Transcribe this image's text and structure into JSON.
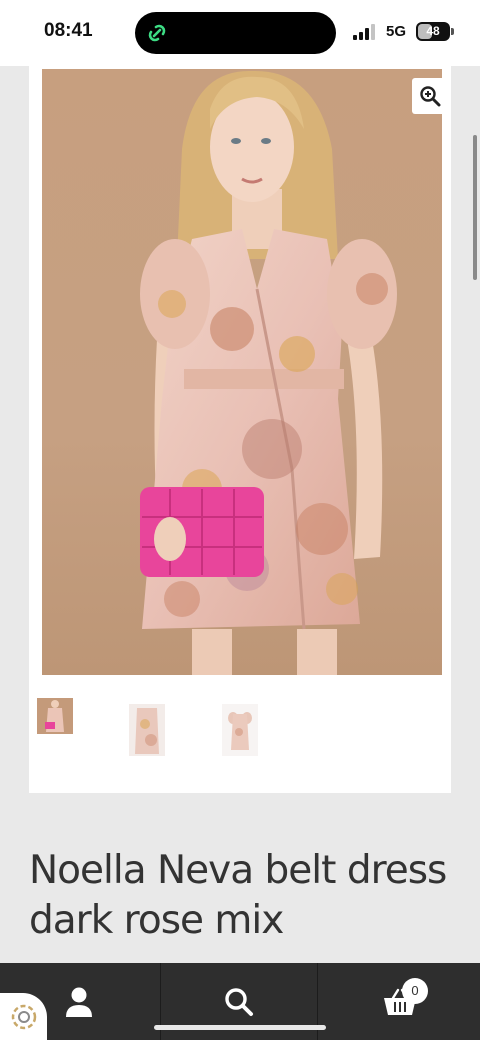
{
  "status_bar": {
    "time": "08:41",
    "network": "5G",
    "battery_level": "48",
    "battery_fraction": 0.48,
    "island_icon": "chain-link-icon",
    "signal_icon": "cellular-signal-icon"
  },
  "product": {
    "title": "Noella Neva belt dress dark rose mix",
    "zoom_icon": "zoom-in-icon",
    "thumbnails": [
      {
        "name": "thumbnail-1"
      },
      {
        "name": "thumbnail-2"
      },
      {
        "name": "thumbnail-3"
      }
    ]
  },
  "bottom_nav": {
    "account_icon": "user-icon",
    "search_icon": "search-icon",
    "cart_icon": "basket-icon",
    "cart_count": "0"
  },
  "colors": {
    "nav_background": "#2e2e2e",
    "image_backdrop": "#c6a082",
    "page_background": "#e9e9e9"
  }
}
